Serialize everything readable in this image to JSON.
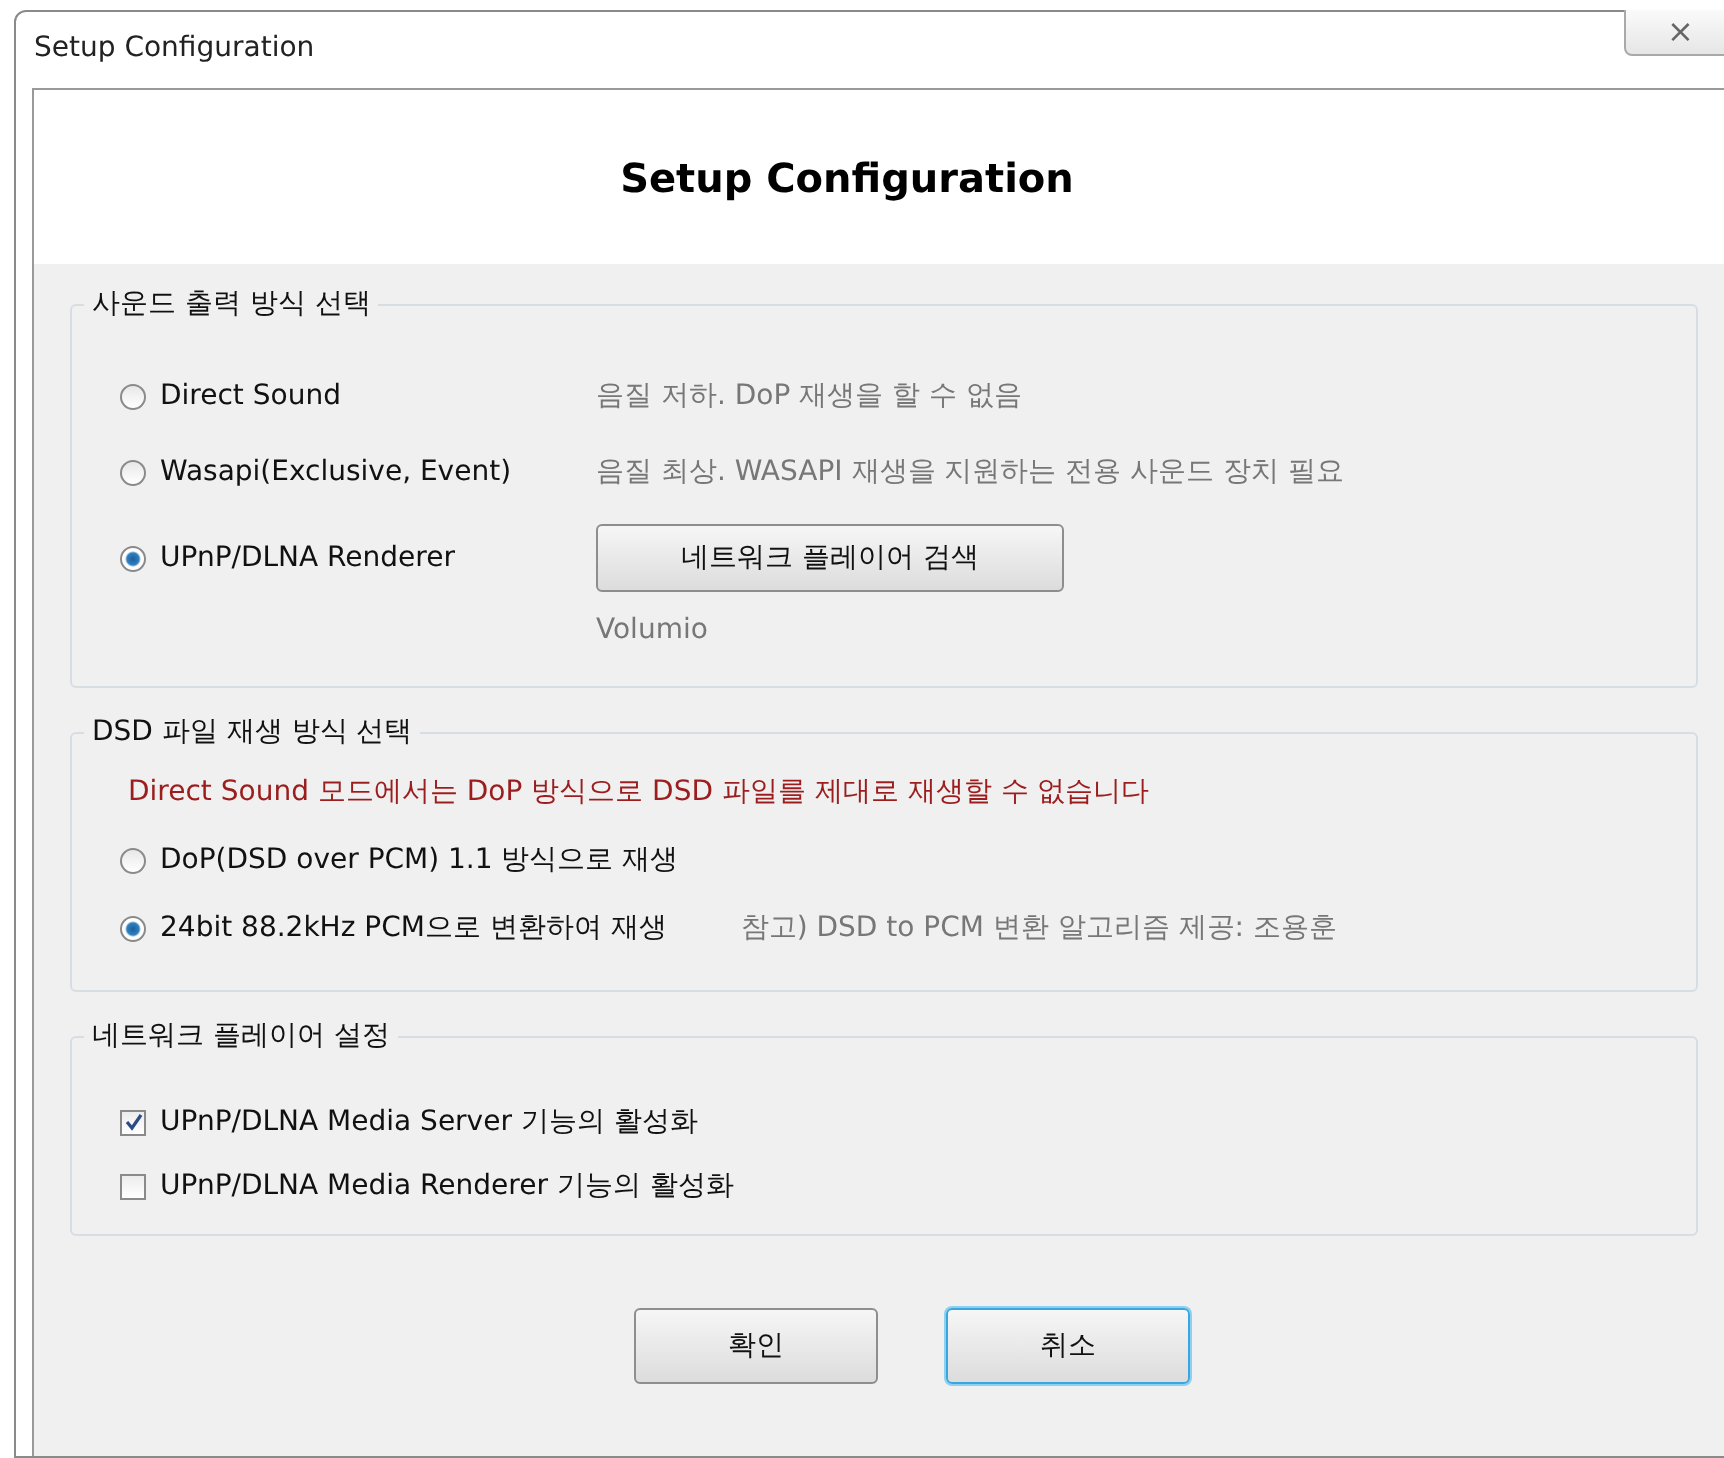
{
  "window": {
    "title": "Setup Configuration",
    "close": "⨯"
  },
  "header": {
    "title": "Setup Configuration"
  },
  "output_group": {
    "legend": "사운드 출력 방식 선택",
    "options": [
      {
        "label": "Direct Sound",
        "selected": false,
        "note": "음질 저하. DoP 재생을 할 수 없음"
      },
      {
        "label": "Wasapi(Exclusive, Event)",
        "selected": false,
        "note": "음질 최상. WASAPI 재생을 지원하는 전용 사운드 장치 필요"
      },
      {
        "label": "UPnP/DLNA Renderer",
        "selected": true,
        "button": "네트워크 플레이어 검색",
        "device": "Volumio"
      }
    ]
  },
  "dsd_group": {
    "legend": "DSD 파일 재생 방식 선택",
    "warning": "Direct Sound 모드에서는 DoP 방식으로 DSD 파일를 제대로 재생할 수 없습니다",
    "options": [
      {
        "label": "DoP(DSD over PCM) 1.1 방식으로 재생",
        "selected": false
      },
      {
        "label": "24bit 88.2kHz PCM으로 변환하여 재생",
        "selected": true,
        "note": "참고) DSD to PCM 변환 알고리즘 제공: 조용훈"
      }
    ]
  },
  "network_group": {
    "legend": "네트워크 플레이어 설정",
    "options": [
      {
        "label": "UPnP/DLNA Media Server 기능의 활성화",
        "checked": true
      },
      {
        "label": "UPnP/DLNA Media Renderer 기능의 활성화",
        "checked": false
      }
    ]
  },
  "buttons": [
    {
      "label": "확인",
      "focused": false
    },
    {
      "label": "취소",
      "focused": true
    }
  ]
}
